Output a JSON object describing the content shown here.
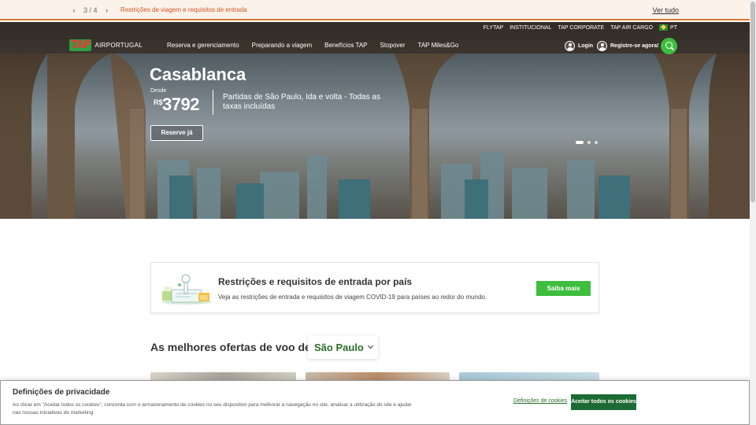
{
  "notice": {
    "counter": "3 / 4",
    "message": "Restrições de viagem e requisitos de entrada",
    "see_all": "Ver tudo"
  },
  "top_links": [
    "FLYTAP",
    "INSTITUCIONAL",
    "TAP CORPORATE",
    "TAP AIR CARGO"
  ],
  "language": "PT",
  "logo_text": "AIRPORTUGAL",
  "logo_mark": "TAP",
  "main_nav": [
    "Reserva e gerenciamento",
    "Preparando a viagem",
    "Benefícios TAP",
    "Stopover",
    "TAP Miles&Go"
  ],
  "auth": {
    "login": "Login",
    "register": "Registre-se agora!"
  },
  "hero": {
    "city": "Casablanca",
    "from_label": "Desde",
    "currency": "R$",
    "price": "3792",
    "description": "Partidas de São Paulo, Ida e volta - Todas as taxas incluídas",
    "cta": "Reserve já",
    "slides": 3,
    "active_slide": 1
  },
  "restrictions": {
    "title": "Restrições e requisitos de entrada por país",
    "text": "Veja as restrições de entrada e requisitos de viagem COVID-19 para países ao redor do mundo.",
    "button": "Saiba mais"
  },
  "offers": {
    "heading": "As melhores ofertas de voo de",
    "origin": "São Paulo"
  },
  "privacy": {
    "title": "Definições de privacidade",
    "text": "Ao clicar em \"Aceitar todos os cookies\", concorda com o armazenamento de cookies no seu dispositivo para melhorar a navegação no site, analisar a utilização do site e ajudar nas nossas iniciativas de marketing.",
    "settings": "Definições de cookies",
    "accept": "Aceitar todos os cookies"
  },
  "colors": {
    "accent_green": "#3ebd3e",
    "dark_green": "#1d6b34",
    "notice_orange": "#d5541f",
    "tap_red": "#e53a2f"
  }
}
